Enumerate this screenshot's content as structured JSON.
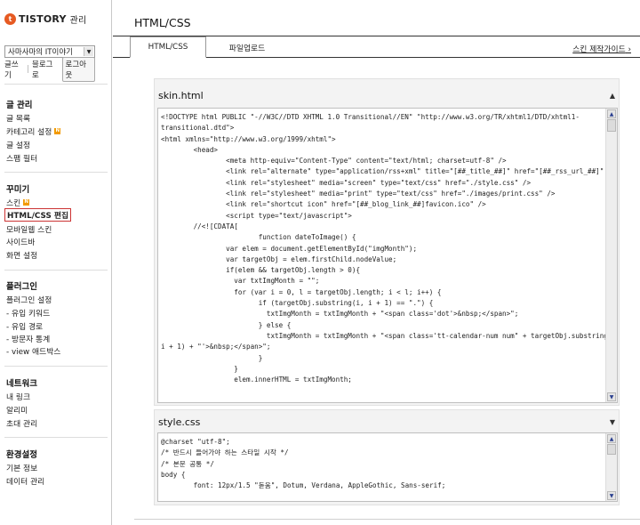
{
  "brand": {
    "logo": "TISTORY",
    "logo_sub": "관리"
  },
  "sidebar": {
    "blog_select": "사마사마의 IT이야기",
    "write": "글쓰기",
    "blog_home": "블로그로",
    "logout": "로그아웃",
    "sections": [
      {
        "title": "글 관리",
        "items": [
          "글 목록",
          "카테고리 설정",
          "글 설정",
          "스팸 필터"
        ]
      },
      {
        "title": "꾸미기",
        "items": [
          "스킨",
          "HTML/CSS 편집",
          "모바일웹 스킨",
          "사이드바",
          "화면 설정"
        ]
      },
      {
        "title": "플러그인",
        "items": [
          "플러그인 설정",
          "- 유입 키워드",
          "- 유입 경로",
          "- 방문자 통계",
          "- view 애드박스"
        ]
      },
      {
        "title": "네트워크",
        "items": [
          "내 링크",
          "알리미",
          "초대 관리"
        ]
      },
      {
        "title": "환경설정",
        "items": [
          "기본 정보",
          "데이터 관리"
        ]
      }
    ],
    "badge": "N"
  },
  "main": {
    "title": "HTML/CSS",
    "tabs": [
      "HTML/CSS",
      "파일업로드"
    ],
    "guide": "스킨 제작가이드",
    "guide_arrow": "›"
  },
  "skin_html": {
    "title": "skin.html",
    "lines": [
      "<!DOCTYPE html PUBLIC \"-//W3C//DTD XHTML 1.0 Transitional//EN\" \"http://www.w3.org/TR/xhtml1/DTD/xhtml1-",
      "transitional.dtd\">",
      "<html xmlns=\"http://www.w3.org/1999/xhtml\">",
      "        <head>",
      "                <meta http-equiv=\"Content-Type\" content=\"text/html; charset=utf-8\" />",
      "                <link rel=\"alternate\" type=\"application/rss+xml\" title=\"[##_title_##]\" href=\"[##_rss_url_##]\" />",
      "                <link rel=\"stylesheet\" media=\"screen\" type=\"text/css\" href=\"./style.css\" />",
      "                <link rel=\"stylesheet\" media=\"print\" type=\"text/css\" href=\"./images/print.css\" />",
      "                <link rel=\"shortcut icon\" href=\"[##_blog_link_##]favicon.ico\" />",
      "                <script type=\"text/javascript\">",
      "        //<![CDATA[",
      "                        function dateToImage() {",
      "                var elem = document.getElementById(\"imgMonth\");",
      "                var targetObj = elem.firstChild.nodeValue;",
      "                if(elem && targetObj.length > 0){",
      "                  var txtImgMonth = \"\";",
      "                  for (var i = 0, l = targetObj.length; i < l; i++) {",
      "                        if (targetObj.substring(i, i + 1) == \".\") {",
      "                          txtImgMonth = txtImgMonth + \"<span class='dot'>&nbsp;</span>\";",
      "                        } else {",
      "                          txtImgMonth = txtImgMonth + \"<span class='tt-calendar-num num\" + targetObj.substring(i,",
      "i + 1) + \"'>&nbsp;</span>\";",
      "                        }",
      "                  }",
      "                  elem.innerHTML = txtImgMonth;"
    ]
  },
  "style_css": {
    "title": "style.css",
    "lines": [
      "@charset \"utf-8\";",
      "/* 반드시 들어가야 하는 스타일 시작 */",
      "/* 본문 공통 */",
      "body {",
      "        font: 12px/1.5 \"돋움\", Dotum, Verdana, AppleGothic, Sans-serif;"
    ]
  }
}
